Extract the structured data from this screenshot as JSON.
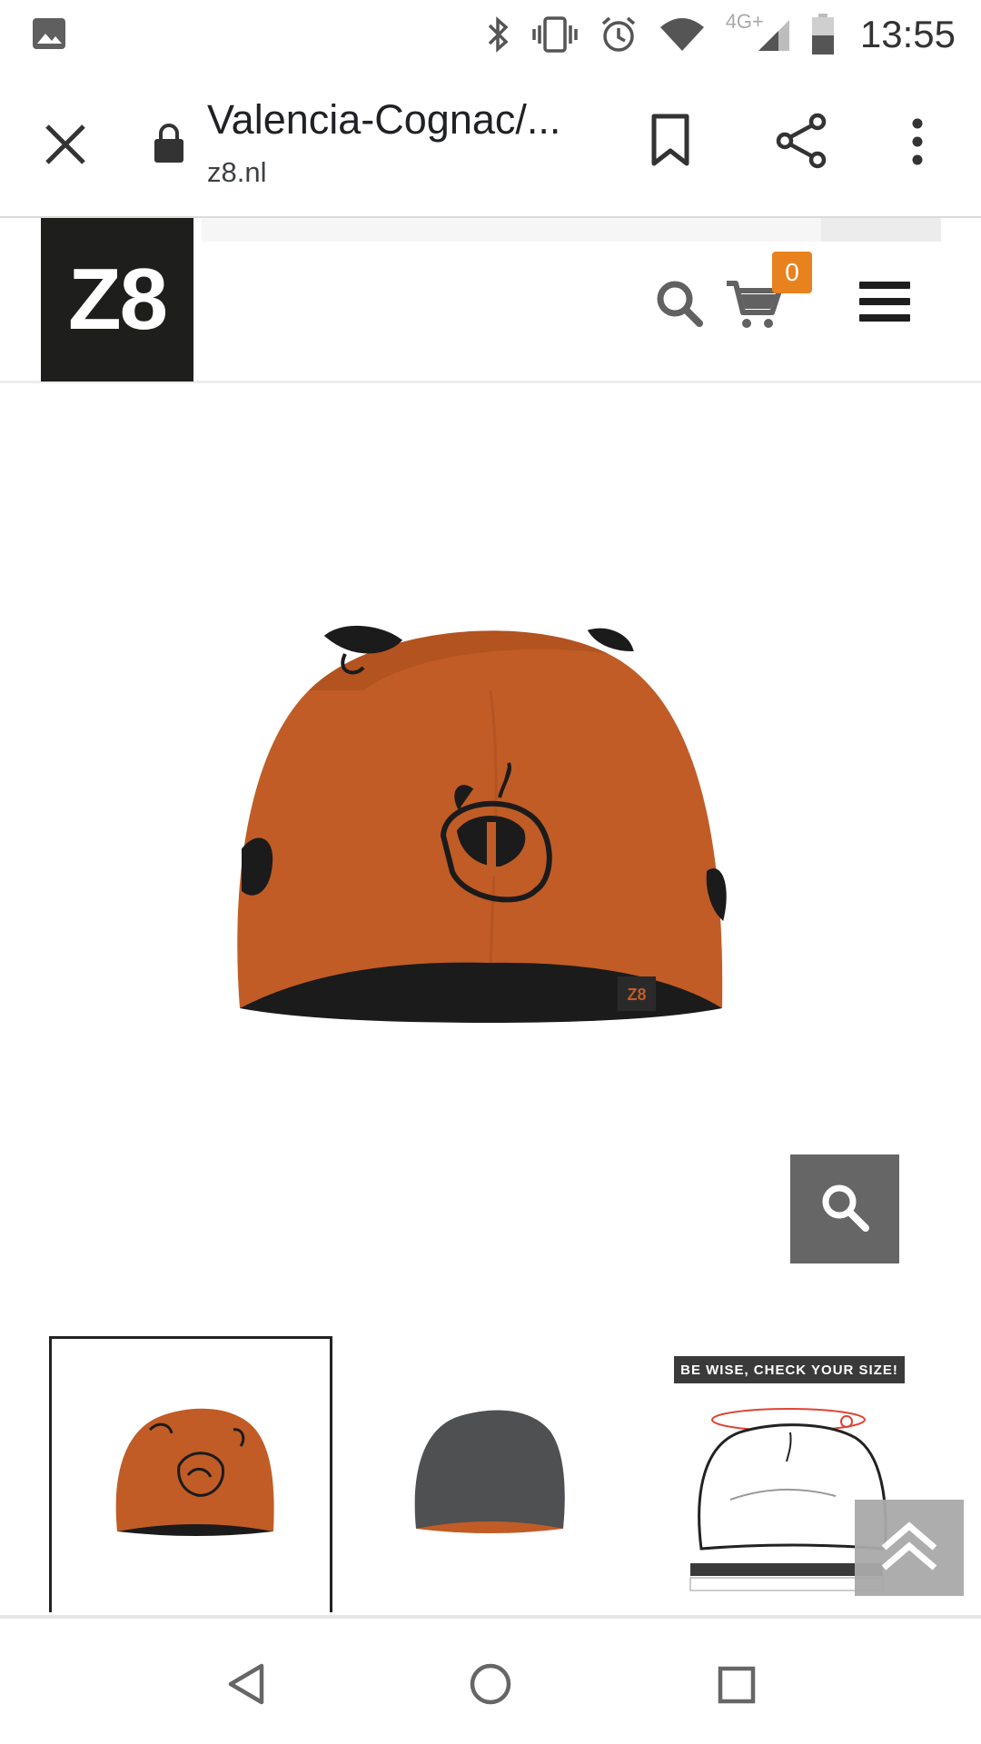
{
  "status_bar": {
    "time": "13:55",
    "network_label": "4G+",
    "icons": [
      "gallery-icon",
      "bluetooth-icon",
      "vibrate-icon",
      "alarm-icon",
      "wifi-icon",
      "signal-icon",
      "battery-icon"
    ]
  },
  "browser": {
    "page_title": "Valencia-Cognac/...",
    "domain": "z8.nl",
    "icons": [
      "close-icon",
      "lock-icon",
      "bookmark-icon",
      "share-icon",
      "more-vert-icon"
    ]
  },
  "site_header": {
    "logo_text": "Z8",
    "cart_count": "0",
    "icons": [
      "search-icon",
      "cart-icon",
      "hamburger-menu-icon"
    ],
    "badge_color": "#e8821e"
  },
  "product": {
    "image": "orange-beanie-hat",
    "hat_color": "#c15c26",
    "thumbnails": [
      {
        "image": "orange-beanie-thumb",
        "active": true
      },
      {
        "image": "grey-beanie-thumb",
        "active": false
      },
      {
        "image": "size-guide-thumb",
        "active": false,
        "banner": "BE WISE, CHECK YOUR SIZE!"
      }
    ]
  },
  "nav_bar": {
    "icons": [
      "back-icon",
      "home-icon",
      "recents-icon"
    ]
  }
}
